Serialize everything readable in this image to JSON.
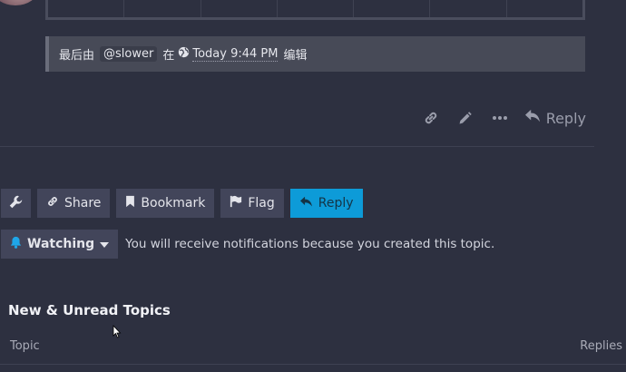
{
  "edit_notice": {
    "prefix": "最后由",
    "user": "@slower",
    "middle": "在",
    "time": "Today 9:44 PM",
    "suffix": "编辑"
  },
  "post_actions": {
    "icons": [
      "link-icon",
      "pencil-icon",
      "more-icon"
    ],
    "reply_label": "Reply"
  },
  "footer_buttons": {
    "share_label": "Share",
    "bookmark_label": "Bookmark",
    "flag_label": "Flag",
    "reply_label": "Reply"
  },
  "notifications": {
    "level_label": "Watching",
    "reason": "You will receive notifications because you created this topic."
  },
  "suggested": {
    "title": "New & Unread Topics",
    "columns": [
      "Topic",
      "Replies"
    ]
  },
  "colors": {
    "background": "#2d3040",
    "button": "#42455a",
    "primary": "#0d9bd8",
    "notice": "#474a57"
  }
}
